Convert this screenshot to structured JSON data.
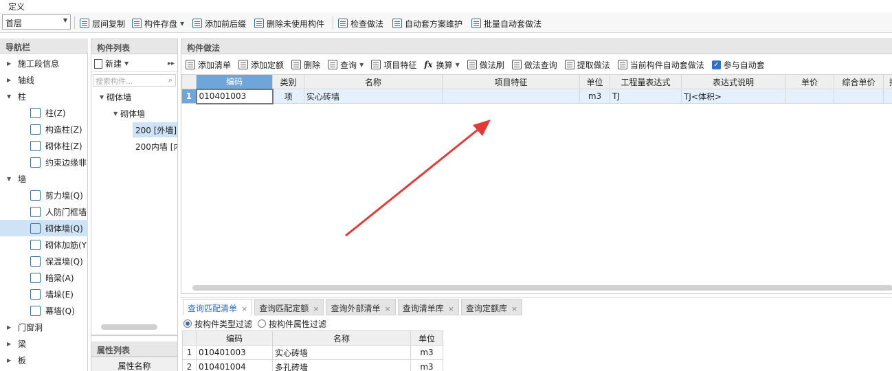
{
  "menu": {
    "title": "定义"
  },
  "toolbar": {
    "floor": "首层",
    "items": [
      {
        "label": "层间复制"
      },
      {
        "label": "构件存盘"
      },
      {
        "label": "添加前后缀"
      },
      {
        "label": "删除未使用构件"
      },
      {
        "label": "检查做法"
      },
      {
        "label": "自动套方案维护"
      },
      {
        "label": "批量自动套做法"
      }
    ]
  },
  "nav": {
    "title": "导航栏",
    "items": [
      {
        "label": "施工段信息",
        "type": "group",
        "expanded": false
      },
      {
        "label": "轴线",
        "type": "group",
        "expanded": false
      },
      {
        "label": "柱",
        "type": "group",
        "expanded": true
      },
      {
        "label": "柱(Z)",
        "type": "child",
        "icon": "column-icon"
      },
      {
        "label": "构造柱(Z)",
        "type": "child",
        "icon": "constructional-column-icon"
      },
      {
        "label": "砌体柱(Z)",
        "type": "child",
        "icon": "masonry-column-icon"
      },
      {
        "label": "约束边缘非",
        "type": "child",
        "icon": "boundary-member-icon"
      },
      {
        "label": "墙",
        "type": "group",
        "expanded": true
      },
      {
        "label": "剪力墙(Q)",
        "type": "child",
        "icon": "shear-wall-icon"
      },
      {
        "label": "人防门框墙",
        "type": "child",
        "icon": "civil-defense-door-wall-icon"
      },
      {
        "label": "砌体墙(Q)",
        "type": "child",
        "icon": "masonry-wall-icon",
        "selected": true
      },
      {
        "label": "砌体加筋(Y",
        "type": "child",
        "icon": "masonry-reinforcement-icon"
      },
      {
        "label": "保温墙(Q)",
        "type": "child",
        "icon": "insulation-wall-icon"
      },
      {
        "label": "暗梁(A)",
        "type": "child",
        "icon": "hidden-beam-icon"
      },
      {
        "label": "墙垛(E)",
        "type": "child",
        "icon": "wall-pier-icon"
      },
      {
        "label": "幕墙(Q)",
        "type": "child",
        "icon": "curtain-wall-icon"
      },
      {
        "label": "门窗洞",
        "type": "group",
        "expanded": false
      },
      {
        "label": "梁",
        "type": "group",
        "expanded": false
      },
      {
        "label": "板",
        "type": "group",
        "expanded": false
      }
    ]
  },
  "component_list": {
    "title": "构件列表",
    "new_label": "新建",
    "search_placeholder": "搜索构件...",
    "tree": [
      {
        "label": "砌体墙",
        "level": 0
      },
      {
        "label": "砌体墙",
        "level": 1
      },
      {
        "label": "200 [外墙]",
        "level": 2,
        "selected": true
      },
      {
        "label": "200内墙 [内",
        "level": 2
      }
    ]
  },
  "properties": {
    "title": "属性列表",
    "header": "属性名称"
  },
  "method": {
    "title": "构件做法",
    "toolbar": [
      {
        "label": "添加清单"
      },
      {
        "label": "添加定额"
      },
      {
        "label": "删除"
      },
      {
        "label": "查询"
      },
      {
        "label": "项目特征"
      },
      {
        "label": "换算"
      },
      {
        "label": "做法刷"
      },
      {
        "label": "做法查询"
      },
      {
        "label": "提取做法"
      },
      {
        "label": "当前构件自动套做法"
      },
      {
        "label": "参与自动套",
        "checked": true
      }
    ],
    "columns": [
      "编码",
      "类别",
      "名称",
      "项目特征",
      "单位",
      "工程量表达式",
      "表达式说明",
      "单价",
      "综合单价",
      "措"
    ],
    "rows": [
      {
        "num": "1",
        "code": "010401003",
        "category": "项",
        "name": "实心砖墙",
        "feature": "",
        "unit": "m3",
        "expr": "TJ",
        "expr_desc": "TJ<体积>",
        "price": "",
        "comp_price": "",
        "extra": ""
      }
    ]
  },
  "bottom": {
    "tabs": [
      {
        "label": "查询匹配清单",
        "active": true
      },
      {
        "label": "查询匹配定额"
      },
      {
        "label": "查询外部清单"
      },
      {
        "label": "查询清单库"
      },
      {
        "label": "查询定额库"
      }
    ],
    "filters": [
      {
        "label": "按构件类型过滤",
        "selected": true
      },
      {
        "label": "按构件属性过滤",
        "selected": false
      }
    ],
    "columns": [
      "编码",
      "名称",
      "单位"
    ],
    "rows": [
      {
        "num": "1",
        "code": "010401003",
        "name": "实心砖墙",
        "unit": "m3"
      },
      {
        "num": "2",
        "code": "010401004",
        "name": "多孔砖墙",
        "unit": "m3"
      }
    ]
  },
  "colors": {
    "accent": "#2f6fc4",
    "selection": "#cfe3f7",
    "annotation_arrow": "#e53935"
  }
}
